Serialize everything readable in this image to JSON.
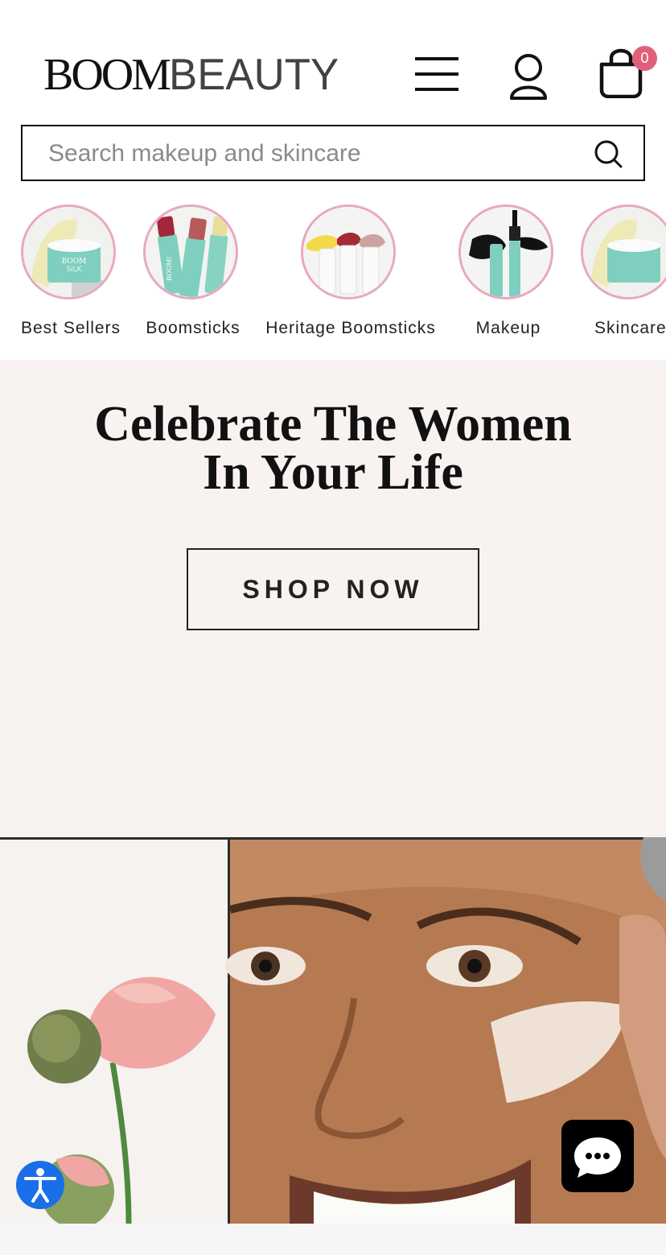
{
  "header": {
    "logo_bold": "BOOM",
    "logo_light": "BEAUTY",
    "icons": {
      "menu": "hamburger-menu-icon",
      "account": "user-icon",
      "cart": "shopping-bag-icon"
    },
    "cart_count": "0"
  },
  "search": {
    "placeholder": "Search makeup and skincare",
    "value": "",
    "icon": "search-icon"
  },
  "categories": [
    {
      "label": "Best Sellers"
    },
    {
      "label": "Boomsticks"
    },
    {
      "label": "Heritage Boomsticks"
    },
    {
      "label": "Makeup"
    },
    {
      "label": "Skincare"
    }
  ],
  "hero": {
    "title_line1": "Celebrate The Women",
    "title_line2": "In Your Life",
    "cta_label": "SHOP NOW"
  },
  "product_text": {
    "boom": "BOOM",
    "silk": "SILK",
    "stick": "BOOM!"
  },
  "colors": {
    "hero_bg": "#f8f3f1",
    "badge": "#e0607a",
    "category_ring": "#e8a8c0",
    "accessibility": "#1a6fe8",
    "product_teal": "#7ecfbf"
  },
  "widgets": {
    "accessibility_icon": "accessibility-icon",
    "chat_icon": "chat-bubble-icon"
  }
}
